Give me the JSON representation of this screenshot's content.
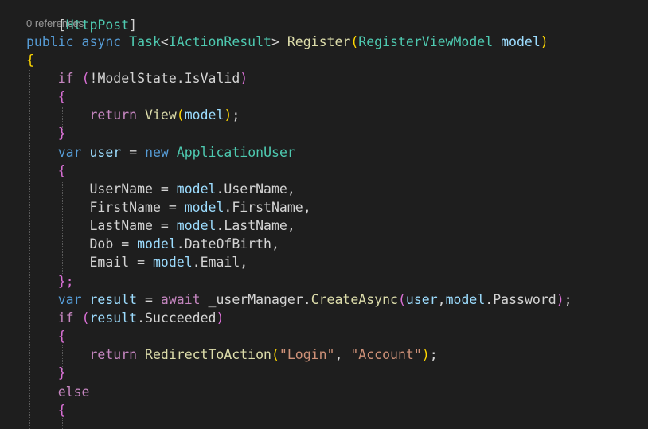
{
  "codelens": "0 references",
  "tokens": {
    "attribute_open": "[",
    "attribute_name": "HttpPost",
    "attribute_close": "]",
    "public": "public",
    "async": "async",
    "task": "Task",
    "lt": "<",
    "iactionresult": "IActionResult",
    "gt": ">",
    "register": "Register",
    "open_paren": "(",
    "close_paren": ")",
    "registerviewmodel": "RegisterViewModel",
    "model": "model",
    "open_brace": "{",
    "close_brace": "}",
    "close_brace_semi": "};",
    "if": "if",
    "not": "!",
    "modelstate": "ModelState",
    "dot": ".",
    "isvalid": "IsValid",
    "return": "return",
    "view": "View",
    "semi": ";",
    "var": "var",
    "user": "user",
    "eq": "=",
    "new": "new",
    "applicationuser": "ApplicationUser",
    "username": "UserName",
    "firstname": "FirstName",
    "lastname": "LastName",
    "dob": "Dob",
    "dateofbirth": "DateOfBirth",
    "email": "Email",
    "comma": ",",
    "result": "result",
    "await": "await",
    "usermanager": "_userManager",
    "createasync": "CreateAsync",
    "password": "Password",
    "succeeded": "Succeeded",
    "redirecttoaction": "RedirectToAction",
    "login_str": "\"Login\"",
    "account_str": "\"Account\"",
    "else": "else"
  }
}
